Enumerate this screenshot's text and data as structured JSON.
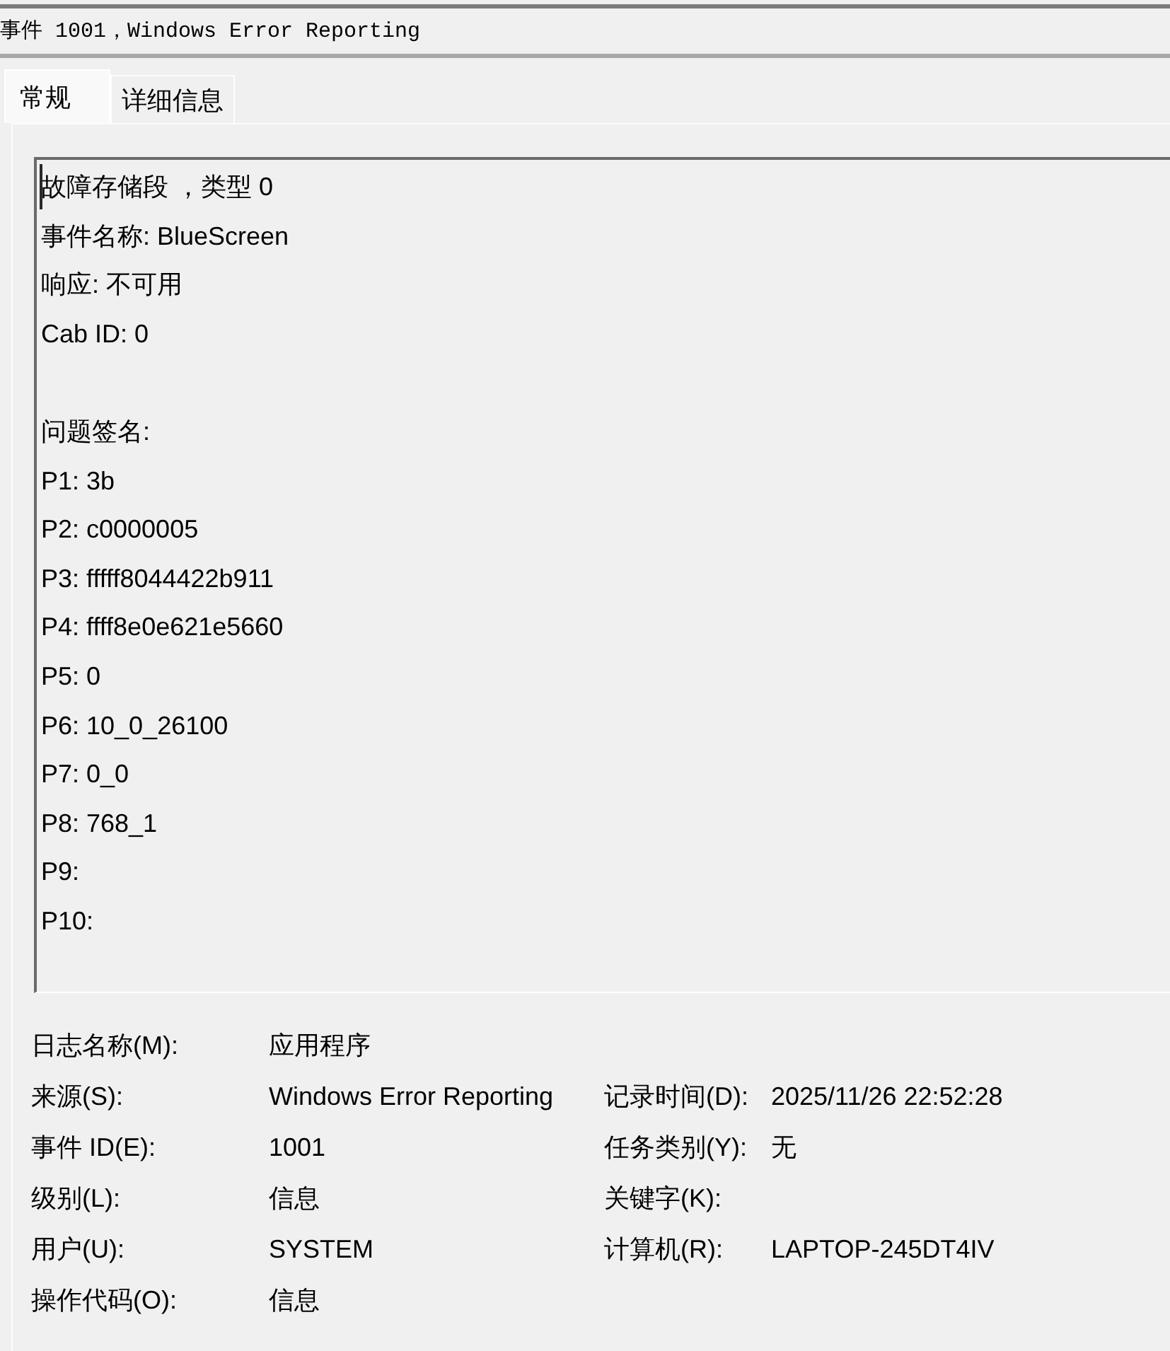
{
  "window": {
    "title": "事件 1001，Windows Error Reporting"
  },
  "tabs": [
    {
      "label": "常规",
      "selected": true
    },
    {
      "label": "详细信息",
      "selected": false
    }
  ],
  "description": {
    "focused": true,
    "paragraphs": [
      [
        "故障存储段 ，类型 0",
        "事件名称: BlueScreen",
        "响应: 不可用",
        "Cab ID: 0"
      ],
      [
        "问题签名:",
        "P1: 3b",
        "P2: c0000005",
        "P3: fffff8044422b911",
        "P4: ffff8e0e621e5660",
        "P5: 0",
        "P6: 10_0_26100",
        "P7: 0_0",
        "P8: 768_1",
        "P9:",
        "P10:"
      ]
    ]
  },
  "properties": [
    {
      "left": {
        "label": "日志名称(M):",
        "value": "应用程序"
      }
    },
    {
      "left": {
        "label": "来源(S):",
        "value": "Windows Error Reporting"
      },
      "right": {
        "label": "记录时间(D):",
        "value": "2025/11/26 22:52:28"
      }
    },
    {
      "left": {
        "label": "事件 ID(E):",
        "value": "1001"
      },
      "right": {
        "label": "任务类别(Y):",
        "value": "无"
      }
    },
    {
      "left": {
        "label": "级别(L):",
        "value": "信息"
      },
      "right": {
        "label": "关键字(K):"
      }
    },
    {
      "left": {
        "label": "用户(U):",
        "value": "SYSTEM"
      },
      "right": {
        "label": "计算机(R):",
        "value": "LAPTOP-245DT4IV"
      }
    },
    {
      "left": {
        "label": "操作代码(O):",
        "value": "信息"
      }
    }
  ]
}
